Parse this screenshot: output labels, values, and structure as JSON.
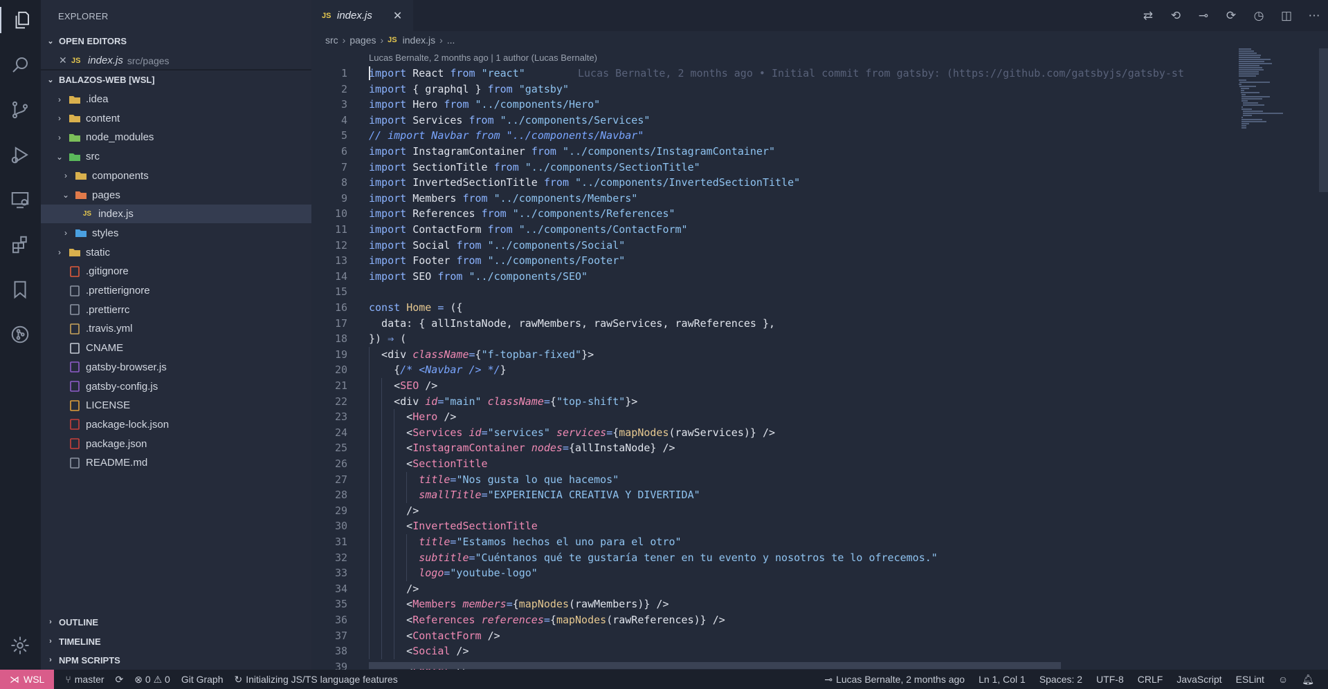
{
  "activity": {
    "items": [
      "explorer-icon",
      "search-icon",
      "source-control-icon",
      "run-debug-icon",
      "remote-explorer-icon",
      "extensions-icon",
      "bookmarks-icon",
      "git-graph-icon",
      "settings-gear-icon"
    ]
  },
  "sidebar": {
    "title": "EXPLORER",
    "open_editors": {
      "label": "OPEN EDITORS",
      "item": {
        "icon": "JS",
        "name": "index.js",
        "path": "src/pages"
      }
    },
    "workspace": {
      "label": "BALAZOS-WEB [WSL]"
    },
    "tree": [
      {
        "name": ".idea",
        "indent": 0,
        "twisty": "›",
        "icon": "folder-idea",
        "color": "#d9b04d"
      },
      {
        "name": "content",
        "indent": 0,
        "twisty": "›",
        "icon": "folder",
        "color": "#d9b04d"
      },
      {
        "name": "node_modules",
        "indent": 0,
        "twisty": "›",
        "icon": "folder-node",
        "color": "#7cbf5a"
      },
      {
        "name": "src",
        "indent": 0,
        "twisty": "⌄",
        "icon": "folder-src",
        "color": "#5bb85b"
      },
      {
        "name": "components",
        "indent": 1,
        "twisty": "›",
        "icon": "folder-components",
        "color": "#d9b04d"
      },
      {
        "name": "pages",
        "indent": 1,
        "twisty": "⌄",
        "icon": "folder-pages",
        "color": "#e07a4a"
      },
      {
        "name": "index.js",
        "indent": 2,
        "twisty": "",
        "icon": "JS",
        "color": "#e6c84f",
        "selected": true
      },
      {
        "name": "styles",
        "indent": 1,
        "twisty": "›",
        "icon": "folder-styles",
        "color": "#4aa0e0"
      },
      {
        "name": "static",
        "indent": 0,
        "twisty": "›",
        "icon": "folder",
        "color": "#d9b04d"
      },
      {
        "name": ".gitignore",
        "indent": 0,
        "twisty": "",
        "icon": "git",
        "color": "#e05a3a"
      },
      {
        "name": ".prettierignore",
        "indent": 0,
        "twisty": "",
        "icon": "prettier",
        "color": "#8d95a3"
      },
      {
        "name": ".prettierrc",
        "indent": 0,
        "twisty": "",
        "icon": "prettier",
        "color": "#8d95a3"
      },
      {
        "name": ".travis.yml",
        "indent": 0,
        "twisty": "",
        "icon": "travis",
        "color": "#c9a35a"
      },
      {
        "name": "CNAME",
        "indent": 0,
        "twisty": "",
        "icon": "file",
        "color": "#c7ccd6"
      },
      {
        "name": "gatsby-browser.js",
        "indent": 0,
        "twisty": "",
        "icon": "gatsby",
        "color": "#8f5cc9"
      },
      {
        "name": "gatsby-config.js",
        "indent": 0,
        "twisty": "",
        "icon": "gatsby",
        "color": "#8f5cc9"
      },
      {
        "name": "LICENSE",
        "indent": 0,
        "twisty": "",
        "icon": "license",
        "color": "#e0a03a"
      },
      {
        "name": "package-lock.json",
        "indent": 0,
        "twisty": "",
        "icon": "npm",
        "color": "#c9403a"
      },
      {
        "name": "package.json",
        "indent": 0,
        "twisty": "",
        "icon": "npm",
        "color": "#c9403a"
      },
      {
        "name": "README.md",
        "indent": 0,
        "twisty": "",
        "icon": "markdown",
        "color": "#8d95a3"
      }
    ],
    "bottom_sections": [
      "OUTLINE",
      "TIMELINE",
      "NPM SCRIPTS"
    ]
  },
  "editor": {
    "tab": {
      "icon": "JS",
      "name": "index.js",
      "close": "✕"
    },
    "breadcrumb": [
      "src",
      "pages",
      "index.js",
      "..."
    ],
    "codelens": "Lucas Bernalte, 2 months ago | 1 author (Lucas Bernalte)",
    "blame": "Lucas Bernalte, 2 months ago • Initial commit from gatsby: (https://github.com/gatsbyjs/gatsby-st",
    "lines": [
      [
        [
          "kw",
          "import"
        ],
        [
          "p",
          " React "
        ],
        [
          "kw",
          "from"
        ],
        [
          "p",
          " "
        ],
        [
          "str",
          "\"react\""
        ]
      ],
      [
        [
          "kw",
          "import"
        ],
        [
          "p",
          " { graphql } "
        ],
        [
          "kw",
          "from"
        ],
        [
          "p",
          " "
        ],
        [
          "str",
          "\"gatsby\""
        ]
      ],
      [
        [
          "kw",
          "import"
        ],
        [
          "p",
          " Hero "
        ],
        [
          "kw",
          "from"
        ],
        [
          "p",
          " "
        ],
        [
          "str",
          "\"../components/Hero\""
        ]
      ],
      [
        [
          "kw",
          "import"
        ],
        [
          "p",
          " Services "
        ],
        [
          "kw",
          "from"
        ],
        [
          "p",
          " "
        ],
        [
          "str",
          "\"../components/Services\""
        ]
      ],
      [
        [
          "cmt",
          "// import Navbar from \"../components/Navbar\""
        ]
      ],
      [
        [
          "kw",
          "import"
        ],
        [
          "p",
          " InstagramContainer "
        ],
        [
          "kw",
          "from"
        ],
        [
          "p",
          " "
        ],
        [
          "str",
          "\"../components/InstagramContainer\""
        ]
      ],
      [
        [
          "kw",
          "import"
        ],
        [
          "p",
          " SectionTitle "
        ],
        [
          "kw",
          "from"
        ],
        [
          "p",
          " "
        ],
        [
          "str",
          "\"../components/SectionTitle\""
        ]
      ],
      [
        [
          "kw",
          "import"
        ],
        [
          "p",
          " InvertedSectionTitle "
        ],
        [
          "kw",
          "from"
        ],
        [
          "p",
          " "
        ],
        [
          "str",
          "\"../components/InvertedSectionTitle\""
        ]
      ],
      [
        [
          "kw",
          "import"
        ],
        [
          "p",
          " Members "
        ],
        [
          "kw",
          "from"
        ],
        [
          "p",
          " "
        ],
        [
          "str",
          "\"../components/Members\""
        ]
      ],
      [
        [
          "kw",
          "import"
        ],
        [
          "p",
          " References "
        ],
        [
          "kw",
          "from"
        ],
        [
          "p",
          " "
        ],
        [
          "str",
          "\"../components/References\""
        ]
      ],
      [
        [
          "kw",
          "import"
        ],
        [
          "p",
          " ContactForm "
        ],
        [
          "kw",
          "from"
        ],
        [
          "p",
          " "
        ],
        [
          "str",
          "\"../components/ContactForm\""
        ]
      ],
      [
        [
          "kw",
          "import"
        ],
        [
          "p",
          " Social "
        ],
        [
          "kw",
          "from"
        ],
        [
          "p",
          " "
        ],
        [
          "str",
          "\"../components/Social\""
        ]
      ],
      [
        [
          "kw",
          "import"
        ],
        [
          "p",
          " Footer "
        ],
        [
          "kw",
          "from"
        ],
        [
          "p",
          " "
        ],
        [
          "str",
          "\"../components/Footer\""
        ]
      ],
      [
        [
          "kw",
          "import"
        ],
        [
          "p",
          " SEO "
        ],
        [
          "kw",
          "from"
        ],
        [
          "p",
          " "
        ],
        [
          "str",
          "\"../components/SEO\""
        ]
      ],
      [],
      [
        [
          "kw",
          "const"
        ],
        [
          "p",
          " "
        ],
        [
          "fn",
          "Home"
        ],
        [
          "p",
          " "
        ],
        [
          "kw",
          "="
        ],
        [
          "p",
          " ({"
        ]
      ],
      [
        [
          "p",
          "  data: { allInstaNode, rawMembers, rawServices, rawReferences },"
        ]
      ],
      [
        [
          "p",
          "}) "
        ],
        [
          "kw",
          "⇒"
        ],
        [
          "p",
          " ("
        ]
      ],
      [
        [
          "p",
          "  <div "
        ],
        [
          "attr",
          "className"
        ],
        [
          "kw",
          "="
        ],
        [
          "p",
          "{"
        ],
        [
          "str",
          "\"f-topbar-fixed\""
        ],
        [
          "p",
          "}>"
        ]
      ],
      [
        [
          "p",
          "    {"
        ],
        [
          "cmt",
          "/* <Navbar /> */"
        ],
        [
          "p",
          "}"
        ]
      ],
      [
        [
          "p",
          "    <"
        ],
        [
          "tag",
          "SEO"
        ],
        [
          "p",
          " />"
        ]
      ],
      [
        [
          "p",
          "    <div "
        ],
        [
          "attr",
          "id"
        ],
        [
          "kw",
          "="
        ],
        [
          "str",
          "\"main\""
        ],
        [
          "p",
          " "
        ],
        [
          "attr",
          "className"
        ],
        [
          "kw",
          "="
        ],
        [
          "p",
          "{"
        ],
        [
          "str",
          "\"top-shift\""
        ],
        [
          "p",
          "}>"
        ]
      ],
      [
        [
          "p",
          "      <"
        ],
        [
          "tag",
          "Hero"
        ],
        [
          "p",
          " />"
        ]
      ],
      [
        [
          "p",
          "      <"
        ],
        [
          "tag",
          "Services"
        ],
        [
          "p",
          " "
        ],
        [
          "attr",
          "id"
        ],
        [
          "kw",
          "="
        ],
        [
          "str",
          "\"services\""
        ],
        [
          "p",
          " "
        ],
        [
          "attr",
          "services"
        ],
        [
          "kw",
          "="
        ],
        [
          "p",
          "{"
        ],
        [
          "fn",
          "mapNodes"
        ],
        [
          "p",
          "(rawServices)} />"
        ]
      ],
      [
        [
          "p",
          "      <"
        ],
        [
          "tag",
          "InstagramContainer"
        ],
        [
          "p",
          " "
        ],
        [
          "attr",
          "nodes"
        ],
        [
          "kw",
          "="
        ],
        [
          "p",
          "{allInstaNode} />"
        ]
      ],
      [
        [
          "p",
          "      <"
        ],
        [
          "tag",
          "SectionTitle"
        ]
      ],
      [
        [
          "p",
          "        "
        ],
        [
          "attr",
          "title"
        ],
        [
          "kw",
          "="
        ],
        [
          "str",
          "\"Nos gusta lo que hacemos\""
        ]
      ],
      [
        [
          "p",
          "        "
        ],
        [
          "attr",
          "smallTitle"
        ],
        [
          "kw",
          "="
        ],
        [
          "str",
          "\"EXPERIENCIA CREATIVA Y DIVERTIDA\""
        ]
      ],
      [
        [
          "p",
          "      />"
        ]
      ],
      [
        [
          "p",
          "      <"
        ],
        [
          "tag",
          "InvertedSectionTitle"
        ]
      ],
      [
        [
          "p",
          "        "
        ],
        [
          "attr",
          "title"
        ],
        [
          "kw",
          "="
        ],
        [
          "str",
          "\"Estamos hechos el uno para el otro\""
        ]
      ],
      [
        [
          "p",
          "        "
        ],
        [
          "attr",
          "subtitle"
        ],
        [
          "kw",
          "="
        ],
        [
          "str",
          "\"Cuéntanos qué te gustaría tener en tu evento y nosotros te lo ofrecemos.\""
        ]
      ],
      [
        [
          "p",
          "        "
        ],
        [
          "attr",
          "logo"
        ],
        [
          "kw",
          "="
        ],
        [
          "str",
          "\"youtube-logo\""
        ]
      ],
      [
        [
          "p",
          "      />"
        ]
      ],
      [
        [
          "p",
          "      <"
        ],
        [
          "tag",
          "Members"
        ],
        [
          "p",
          " "
        ],
        [
          "attr",
          "members"
        ],
        [
          "kw",
          "="
        ],
        [
          "p",
          "{"
        ],
        [
          "fn",
          "mapNodes"
        ],
        [
          "p",
          "(rawMembers)} />"
        ]
      ],
      [
        [
          "p",
          "      <"
        ],
        [
          "tag",
          "References"
        ],
        [
          "p",
          " "
        ],
        [
          "attr",
          "references"
        ],
        [
          "kw",
          "="
        ],
        [
          "p",
          "{"
        ],
        [
          "fn",
          "mapNodes"
        ],
        [
          "p",
          "(rawReferences)} />"
        ]
      ],
      [
        [
          "p",
          "      <"
        ],
        [
          "tag",
          "ContactForm"
        ],
        [
          "p",
          " />"
        ]
      ],
      [
        [
          "p",
          "      <"
        ],
        [
          "tag",
          "Social"
        ],
        [
          "p",
          " />"
        ]
      ],
      [
        [
          "p",
          "      <"
        ],
        [
          "tag",
          "Footer"
        ],
        [
          "p",
          " />"
        ]
      ]
    ]
  },
  "status": {
    "remote": "WSL",
    "branch": "master",
    "sync": "⟳",
    "problems": "⊗ 0 ⚠ 0",
    "git_graph": "Git Graph",
    "progress": "Initializing JS/TS language features",
    "blame": "Lucas Bernalte, 2 months ago",
    "position": "Ln 1, Col 1",
    "spaces": "Spaces: 2",
    "encoding": "UTF-8",
    "eol": "CRLF",
    "language": "JavaScript",
    "linter": "ESLint"
  }
}
